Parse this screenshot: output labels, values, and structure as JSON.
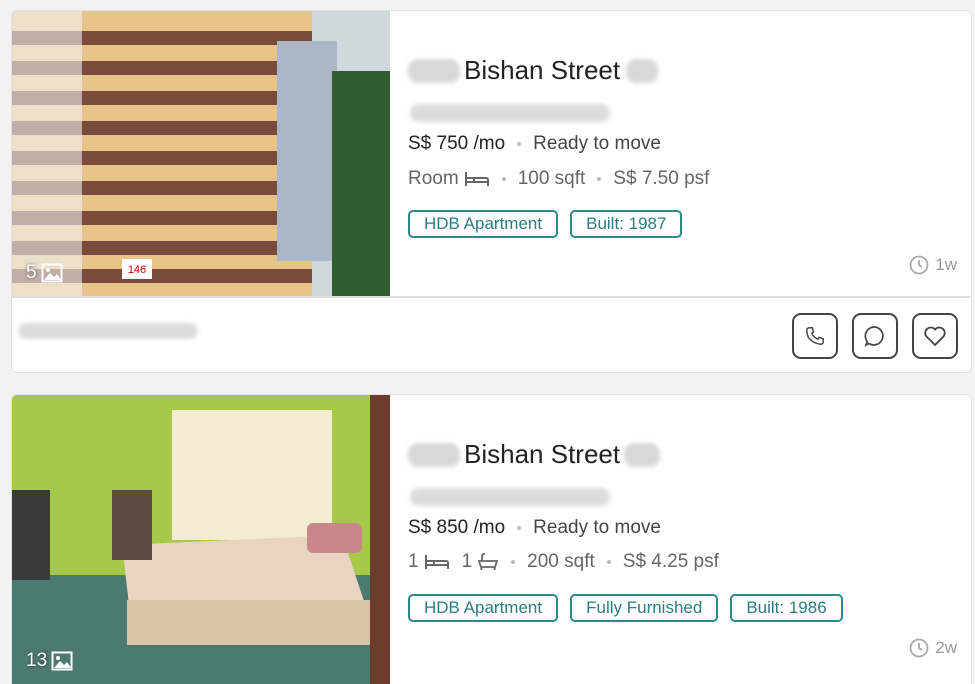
{
  "listings": [
    {
      "photo_count": "5",
      "title": "Bishan Street",
      "price": "S$ 750 /mo",
      "availability": "Ready to move",
      "room_type": "Room",
      "size": "100 sqft",
      "psf": "S$ 7.50 psf",
      "tags": [
        "HDB Apartment",
        "Built: 1987"
      ],
      "age": "1w"
    },
    {
      "photo_count": "13",
      "title": "Bishan Street",
      "price": "S$ 850 /mo",
      "availability": "Ready to move",
      "beds": "1",
      "baths": "1",
      "size": "200 sqft",
      "psf": "S$ 4.25 psf",
      "tags": [
        "HDB Apartment",
        "Fully Furnished",
        "Built: 1986"
      ],
      "age": "2w"
    }
  ],
  "colors": {
    "accent": "#2a8a8f",
    "divider": "#e0e0e0"
  },
  "icons": [
    "image-icon",
    "bed-icon",
    "bath-icon",
    "clock-icon",
    "phone-icon",
    "chat-icon",
    "heart-icon"
  ]
}
